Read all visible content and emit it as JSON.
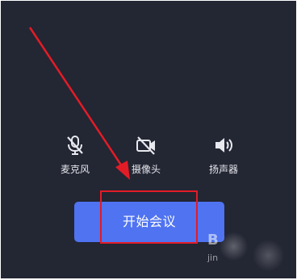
{
  "controls": {
    "microphone": {
      "label": "麦克风",
      "icon": "microphone-muted-icon"
    },
    "camera": {
      "label": "摄像头",
      "icon": "camera-off-icon"
    },
    "speaker": {
      "label": "扬声器",
      "icon": "speaker-icon"
    }
  },
  "start_meeting": {
    "label": "开始会议"
  },
  "watermark": {
    "text_top": "B",
    "text_bottom": "jin"
  },
  "colors": {
    "background": "#232633",
    "button": "#4f73f1",
    "annotation": "#e21c27"
  }
}
